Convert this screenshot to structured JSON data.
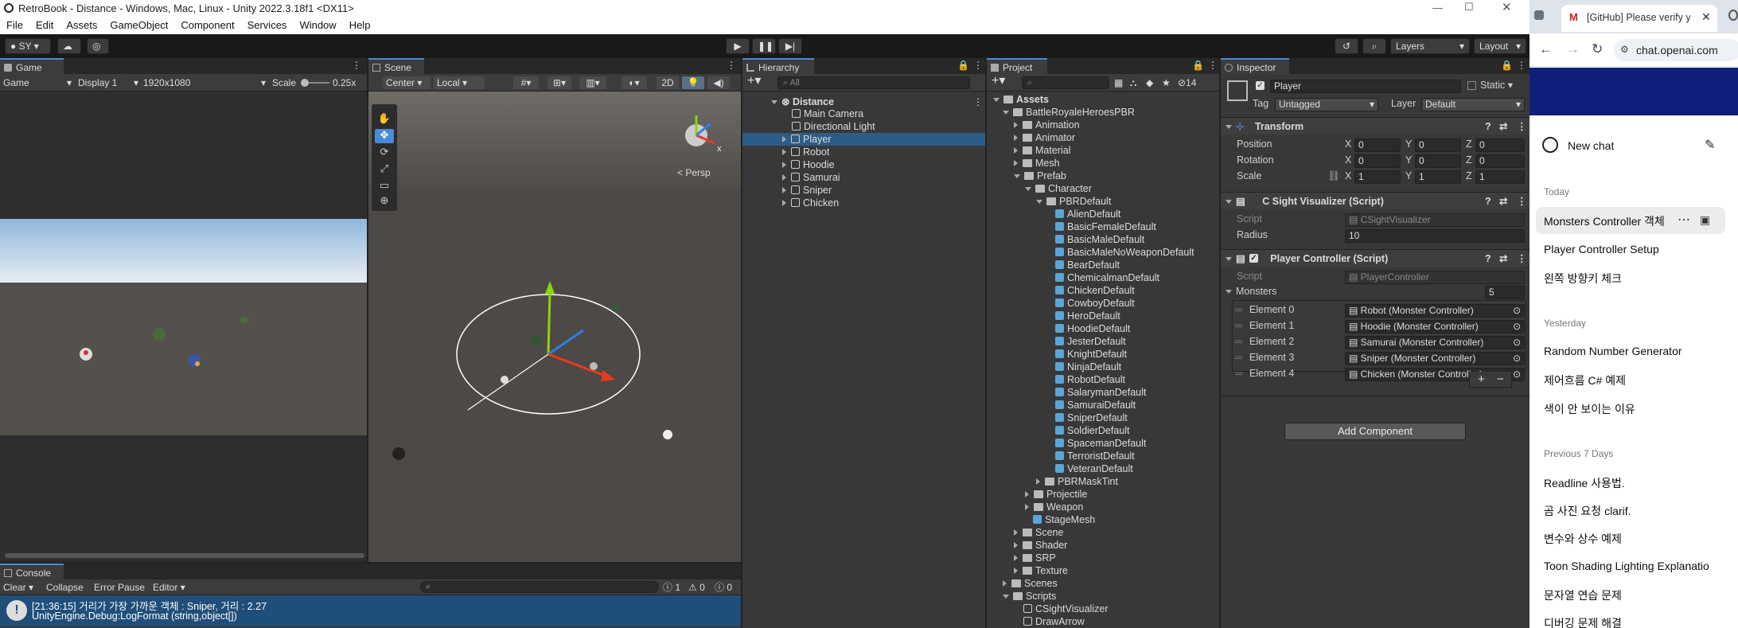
{
  "unity": {
    "window_title": "RetroBook - Distance - Windows, Mac, Linux - Unity 2022.3.18f1 <DX11>",
    "menu": [
      "File",
      "Edit",
      "Assets",
      "GameObject",
      "Component",
      "Services",
      "Window",
      "Help"
    ],
    "account": "SY",
    "layers": "Layers",
    "layout": "Layout"
  },
  "game": {
    "tab": "Game",
    "mode": "Game",
    "display": "Display 1",
    "resolution": "1920x1080",
    "scale_label": "Scale",
    "scale_value": "0.25x"
  },
  "scene": {
    "tab": "Scene",
    "pivot": "Center",
    "space": "Local",
    "two_d": "2D",
    "persp": "< Persp"
  },
  "console": {
    "tab": "Console",
    "clear": "Clear",
    "collapse": "Collapse",
    "error_pause": "Error Pause",
    "editor": "Editor",
    "count_log": "1",
    "count_warn": "0",
    "count_err": "0",
    "msg_line1": "[21:36:15] 거리가 가장 가까운 객체 : Sniper, 거리 : 2.27",
    "msg_line2": "UnityEngine.Debug:LogFormat (string,object[])"
  },
  "hierarchy": {
    "tab": "Hierarchy",
    "search": "All",
    "scene_name": "Distance",
    "items": [
      "Main Camera",
      "Directional Light",
      "Player",
      "Robot",
      "Hoodie",
      "Samurai",
      "Sniper",
      "Chicken"
    ]
  },
  "project": {
    "tab": "Project",
    "count": "14",
    "assets": "Assets",
    "root": "BattleRoyaleHeroesPBR",
    "folders_top": [
      "Animation",
      "Animator",
      "Material",
      "Mesh"
    ],
    "prefab": "Prefab",
    "character": "Character",
    "pbrdefault": "PBRDefault",
    "prefabs": [
      "AlienDefault",
      "BasicFemaleDefault",
      "BasicMaleDefault",
      "BasicMaleNoWeaponDefault",
      "BearDefault",
      "ChemicalmanDefault",
      "ChickenDefault",
      "CowboyDefault",
      "HeroDefault",
      "HoodieDefault",
      "JesterDefault",
      "KnightDefault",
      "NinjaDefault",
      "RobotDefault",
      "SalarymanDefault",
      "SamuraiDefault",
      "SniperDefault",
      "SoldierDefault",
      "SpacemanDefault",
      "TerroristDefault",
      "VeteranDefault"
    ],
    "pbrmasktint": "PBRMaskTint",
    "projectile": "Projectile",
    "weapon": "Weapon",
    "stagemesh": "StageMesh",
    "folders_bottom": [
      "Scene",
      "Shader",
      "SRP",
      "Texture"
    ],
    "scenes": "Scenes",
    "scripts": "Scripts",
    "script_files": [
      "CSightVisualizer",
      "DrawArrow"
    ]
  },
  "inspector": {
    "tab": "Inspector",
    "object_name": "Player",
    "static": "Static",
    "tag_label": "Tag",
    "tag": "Untagged",
    "layer_label": "Layer",
    "layer": "Default",
    "transform": "Transform",
    "position": "Position",
    "rotation": "Rotation",
    "scale": "Scale",
    "pos": [
      "0",
      "0",
      "0"
    ],
    "rot": [
      "0",
      "0",
      "0"
    ],
    "scl": [
      "1",
      "1",
      "1"
    ],
    "sight": "C Sight Visualizer (Script)",
    "script_label": "Script",
    "sight_script": "CSightVisualizer",
    "radius_label": "Radius",
    "radius": "10",
    "pc": "Player Controller (Script)",
    "pc_script": "PlayerController",
    "monsters_label": "Monsters",
    "monsters_count": "5",
    "elements": [
      {
        "label": "Element 0",
        "value": "Robot (Monster Controller)"
      },
      {
        "label": "Element 1",
        "value": "Hoodie (Monster Controller)"
      },
      {
        "label": "Element 2",
        "value": "Samurai (Monster Controller)"
      },
      {
        "label": "Element 3",
        "value": "Sniper (Monster Controller)"
      },
      {
        "label": "Element 4",
        "value": "Chicken (Monster Controller)"
      }
    ],
    "add_component": "Add Component"
  },
  "browser": {
    "tab_title": "[GitHub] Please verify yo",
    "url": "chat.openai.com",
    "new_chat": "New chat",
    "today": "Today",
    "today_items": [
      "Monsters Controller 객체",
      "Player Controller Setup",
      "왼쪽 방향키 체크"
    ],
    "yesterday": "Yesterday",
    "yesterday_items": [
      "Random Number Generator",
      "제어흐름 C# 예제",
      "색이 안 보이는 이유"
    ],
    "prev7": "Previous 7 Days",
    "prev7_items": [
      "Readline 사용법.",
      "곰 사진 요청 clarif.",
      "변수와 상수 예제",
      "Toon Shading Lighting Explanatio",
      "문자열 연습 문제",
      "디버깅 문제 해결"
    ]
  },
  "colors": {
    "accent": "#4a8ad6",
    "selection": "#2c5d87",
    "console_bg": "#1f4e7a"
  }
}
